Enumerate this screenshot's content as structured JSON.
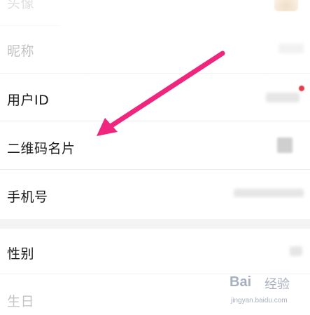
{
  "rows": [
    {
      "label": "头像"
    },
    {
      "label": "昵称"
    },
    {
      "label": "用户ID"
    },
    {
      "label": "二维码名片"
    },
    {
      "label": "手机号"
    },
    {
      "label": "性别"
    },
    {
      "label": "生日"
    }
  ],
  "watermark": {
    "logo_text": "Bai",
    "brand_text": "经验",
    "url_text": "jingyan.baidu.com"
  },
  "colors": {
    "arrow": "#f0257d",
    "notification_dot": "#e83b4a"
  }
}
